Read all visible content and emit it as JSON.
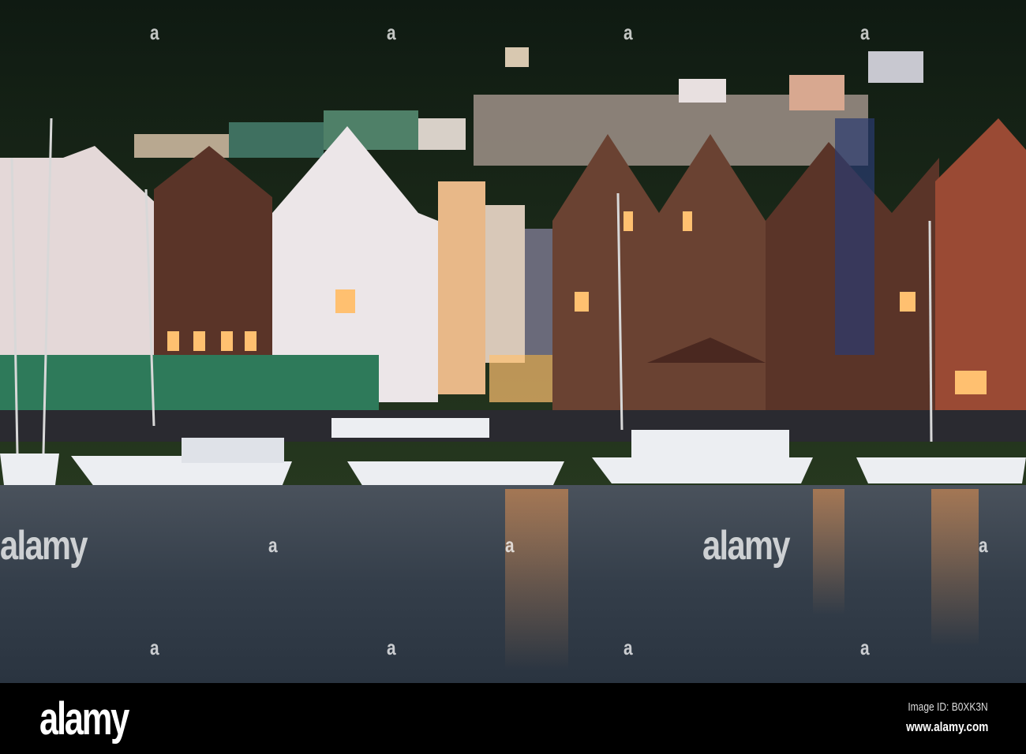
{
  "photo": {
    "subject": "Harbour waterfront at dusk",
    "colors": {
      "hill": "#1c2a1a",
      "water": "#3a4550",
      "light": "#ffb060"
    }
  },
  "watermark": {
    "text": "alamy",
    "letter": "a"
  },
  "footer": {
    "logo": "alamy",
    "image_id": "Image ID: B0XK3N",
    "website": "www.alamy.com"
  }
}
